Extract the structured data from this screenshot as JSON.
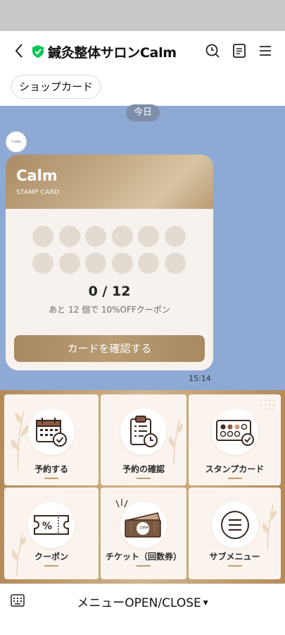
{
  "header": {
    "title": "鍼灸整体サロンCalm",
    "verified_color": "#06c755"
  },
  "chip": {
    "label": "ショップカード"
  },
  "chat": {
    "date_label": "今日",
    "avatar_text": "Calm",
    "time": "15:14",
    "background": "#8ea9d4"
  },
  "card": {
    "title": "Calm",
    "subtitle": "STAMP CARD",
    "stamps_total": 12,
    "stamps_filled": 0,
    "count_text": "0 / 12",
    "hint_text": "あと 12 個で 10%OFFクーポン",
    "button_label": "カードを確認する"
  },
  "menu": {
    "items": [
      {
        "label": "予約する",
        "icon": "calendar-check-icon"
      },
      {
        "label": "予約の確認",
        "icon": "clipboard-clock-icon"
      },
      {
        "label": "スタンプカード",
        "icon": "stamp-card-icon"
      },
      {
        "label": "クーポン",
        "icon": "coupon-icon"
      },
      {
        "label": "チケット（回数券）",
        "icon": "ticket-icon",
        "ticket_text": "回数券"
      },
      {
        "label": "サブメニュー",
        "icon": "hamburger-circle-icon"
      }
    ]
  },
  "bottom_bar": {
    "toggle_label": "メニューOPEN/CLOSE"
  }
}
